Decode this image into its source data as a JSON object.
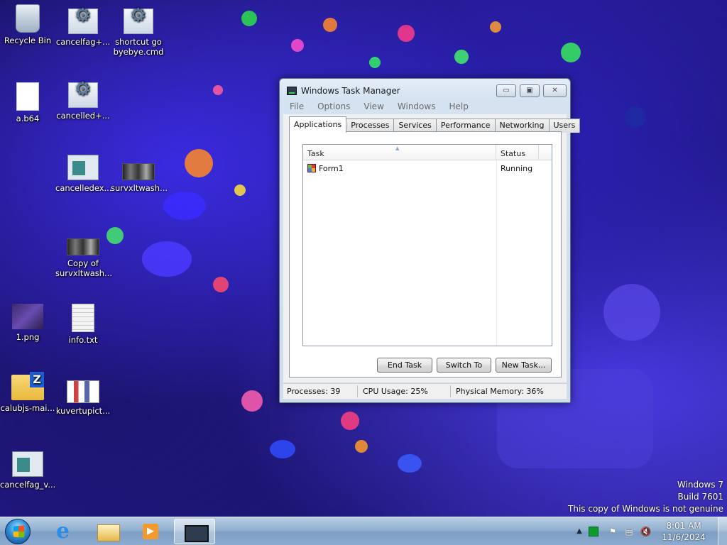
{
  "desktop": {
    "icons": [
      {
        "label": "Recycle Bin"
      },
      {
        "label": "cancelfag+..."
      },
      {
        "label": "shortcut go byebye.cmd"
      },
      {
        "label": "a.b64"
      },
      {
        "label": "cancelled+..."
      },
      {
        "label": "cancelledex..."
      },
      {
        "label": "survxltwash..."
      },
      {
        "label": "Copy of survxltwash..."
      },
      {
        "label": "1.png"
      },
      {
        "label": "info.txt"
      },
      {
        "label": "calubjs-mai..."
      },
      {
        "label": "kuvertupict..."
      },
      {
        "label": "cancelfag_v..."
      }
    ],
    "watermark": {
      "line1": "Windows 7",
      "line2": "Build 7601",
      "line3": "This copy of Windows is not genuine"
    }
  },
  "task_manager": {
    "title": "Windows Task Manager",
    "caption_buttons": {
      "minimize": "▭",
      "maximize": "▣",
      "close": "✕"
    },
    "menu": [
      "File",
      "Options",
      "View",
      "Windows",
      "Help"
    ],
    "tabs": [
      "Applications",
      "Processes",
      "Services",
      "Performance",
      "Networking",
      "Users"
    ],
    "active_tab": "Applications",
    "columns": {
      "task": "Task",
      "status": "Status"
    },
    "rows": [
      {
        "task": "Form1",
        "status": "Running"
      }
    ],
    "buttons": {
      "end_task": "End Task",
      "switch_to": "Switch To",
      "new_task": "New Task..."
    },
    "statusbar": {
      "processes": "Processes: 39",
      "cpu": "CPU Usage: 25%",
      "memory": "Physical Memory: 36%"
    }
  },
  "taskbar": {
    "clock": {
      "time": "8:01 AM",
      "date": "11/6/2024"
    },
    "pinned": [
      "internet-explorer-icon",
      "windows-explorer-icon",
      "media-player-icon",
      "task-manager-icon"
    ],
    "tray": {
      "show_hidden": "▲",
      "action_center": "⚑",
      "network": "▤",
      "volume": "🔇"
    }
  }
}
